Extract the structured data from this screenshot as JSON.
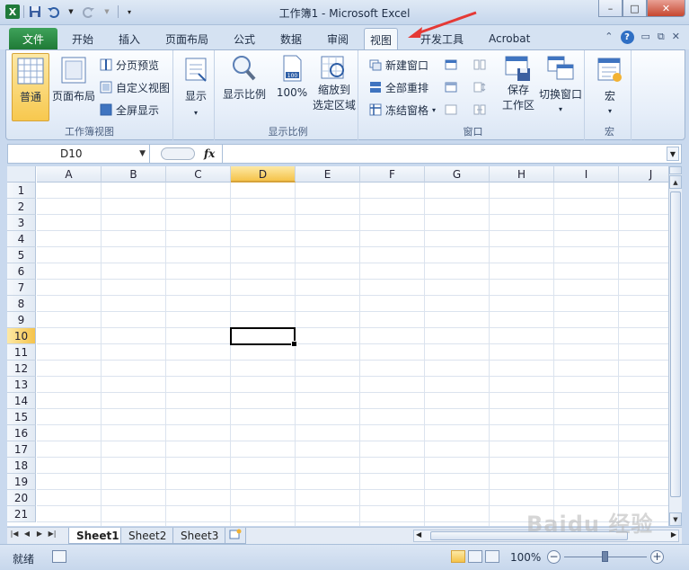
{
  "window": {
    "title": "工作簿1 - Microsoft Excel",
    "controls": {
      "minimize": "–",
      "maximize": "□",
      "close": "✕"
    }
  },
  "quick_access": {
    "app_icon": "X",
    "save": "save-icon",
    "undo": "undo-icon",
    "redo": "redo-icon"
  },
  "ribbon_tabs": [
    "文件",
    "开始",
    "插入",
    "页面布局",
    "公式",
    "数据",
    "审阅",
    "视图",
    "开发工具",
    "Acrobat"
  ],
  "active_tab": "视图",
  "ribbon": {
    "workbook_views": {
      "label": "工作簿视图",
      "normal": "普通",
      "page_layout": "页面布局",
      "page_break_preview": "分页预览",
      "custom_views": "自定义视图",
      "full_screen": "全屏显示"
    },
    "show": {
      "label": "显示"
    },
    "zoom": {
      "label": "显示比例",
      "zoom": "显示比例",
      "hundred": "100%",
      "hundred_icon_text": "100",
      "zoom_to_selection_line1": "缩放到",
      "zoom_to_selection_line2": "选定区域"
    },
    "window": {
      "label": "窗口",
      "new_window": "新建窗口",
      "arrange_all": "全部重排",
      "freeze_panes": "冻结窗格",
      "save_workspace_line1": "保存",
      "save_workspace_line2": "工作区",
      "switch_windows": "切换窗口"
    },
    "macros": {
      "label": "宏",
      "macros": "宏"
    }
  },
  "formula_bar": {
    "name_box": "D10",
    "fx": "fx",
    "formula": ""
  },
  "grid": {
    "columns": [
      "A",
      "B",
      "C",
      "D",
      "E",
      "F",
      "G",
      "H",
      "I",
      "J"
    ],
    "rows": [
      "1",
      "2",
      "3",
      "4",
      "5",
      "6",
      "7",
      "8",
      "9",
      "10",
      "11",
      "12",
      "13",
      "14",
      "15",
      "16",
      "17",
      "18",
      "19",
      "20",
      "21"
    ],
    "selected_column": "D",
    "selected_row": "10",
    "active_cell": "D10"
  },
  "sheets": [
    "Sheet1",
    "Sheet2",
    "Sheet3"
  ],
  "active_sheet": "Sheet1",
  "status_bar": {
    "ready": "就绪",
    "zoom_level": "100%"
  },
  "watermark": "Baidu 经验",
  "colors": {
    "file_tab": "#1f7a36",
    "selected_header": "#f5c34a",
    "annotation_arrow": "#e53935"
  }
}
